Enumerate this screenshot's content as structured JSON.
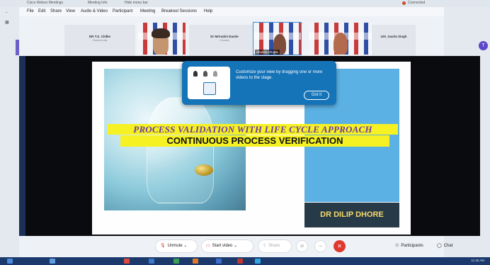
{
  "window": {
    "title": "Cisco Webex Meetings",
    "tab2": "Meeting Info",
    "tab3": "Hide menu bar",
    "status": "Connected"
  },
  "menu": [
    "File",
    "Edit",
    "Share",
    "View",
    "Audio & Video",
    "Participant",
    "Meeting",
    "Breakout Sessions",
    "Help"
  ],
  "participants": [
    {
      "name": "DR T.S. Chilke",
      "sub": "Connect only",
      "video": false
    },
    {
      "name": "",
      "sub": "",
      "video": true
    },
    {
      "name": "Dr Mrinalini Damle",
      "sub": "Connect",
      "video": false
    },
    {
      "name": "Shubha Shukla",
      "sub": "",
      "video": true
    },
    {
      "name": "",
      "sub": "",
      "video": true
    },
    {
      "name": "100_Savita Singh",
      "sub": "",
      "video": false
    }
  ],
  "slide": {
    "title": "PROCESS VALIDATION WITH LIFE CYCLE APPROACH",
    "subtitle": "CONTINUOUS PROCESS VERIFICATION",
    "author": "DR DILIP DHORE"
  },
  "tooltip": {
    "text": "Customize your view by dragging one or more videos to the stage.",
    "button": "Got it"
  },
  "controls": {
    "unmute": "Unmute",
    "start_video": "Start video",
    "share": "Share",
    "participants": "Participants",
    "chat": "Chat"
  },
  "taskbar": {
    "time": "11:35 AM"
  }
}
